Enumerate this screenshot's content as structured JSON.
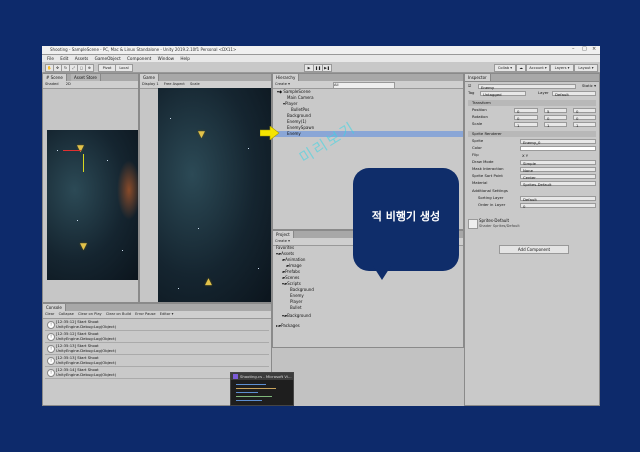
{
  "window": {
    "title": "Shooting - SampleScene - PC, Mac & Linux Standalone - Unity 2019.2.10f1 Personal <DX11>",
    "controls": [
      "–",
      "□",
      "×"
    ]
  },
  "menu": [
    "File",
    "Edit",
    "Assets",
    "GameObject",
    "Component",
    "Window",
    "Help"
  ],
  "toolbar": {
    "pivot_label": "Pivot",
    "local_label": "Local",
    "collab_label": "Collab ▾",
    "account_label": "Account ▾",
    "layers_label": "Layers ▾",
    "layout_label": "Layout ▾",
    "play_icons": [
      "▶",
      "❚❚",
      "▶❚"
    ]
  },
  "scene_panel": {
    "tabs": [
      "# Scene",
      "Asset Store"
    ],
    "shaded_label": "Shaded",
    "mode_label": "2D"
  },
  "game_panel": {
    "tab": "Game",
    "display_label": "Display 1",
    "resolution_label": "Free Aspect",
    "scale_label": "Scale"
  },
  "hierarchy": {
    "tab": "Hierarchy",
    "create_label": "Create ▾",
    "search_placeholder": "All",
    "scene_name": "SampleScene",
    "items": [
      "Main Camera",
      "Player",
      "BulletPos",
      "Background",
      "Enemy(1)",
      "EnemySpawn",
      "Enemy"
    ],
    "selected_index": 6
  },
  "project": {
    "tab": "Project",
    "create_label": "Create ▾",
    "tree": [
      "Favorites",
      "Assets",
      "Animation",
      "Image",
      "Prefabs",
      "Scenes",
      "Scripts",
      "Background",
      "Enemy",
      "Player",
      "Bullet",
      "Background",
      "Packages"
    ]
  },
  "inspector": {
    "tab": "Inspector",
    "object_name": "Enemy",
    "tag_label": "Tag",
    "tag_value": "Untagged",
    "layer_label": "Layer",
    "layer_value": "Default",
    "static_label": "Static ▾",
    "transform_title": "Transform",
    "transform": [
      {
        "label": "Position",
        "x": "0",
        "y": "5",
        "z": "0"
      },
      {
        "label": "Rotation",
        "x": "0",
        "y": "0",
        "z": "0"
      },
      {
        "label": "Scale",
        "x": "1",
        "y": "1",
        "z": "1"
      }
    ],
    "sprite_renderer_title": "Sprite Renderer",
    "sprite_rows": [
      {
        "label": "Sprite",
        "value": "Enemy_0"
      },
      {
        "label": "Color",
        "value": ""
      },
      {
        "label": "Flip",
        "value": "X  Y"
      },
      {
        "label": "Draw Mode",
        "value": "Simple"
      },
      {
        "label": "Mask Interaction",
        "value": "None"
      },
      {
        "label": "Sprite Sort Point",
        "value": "Center"
      },
      {
        "label": "Material",
        "value": "Sprites-Default"
      }
    ],
    "additional_title": "Additional Settings",
    "additional_rows": [
      {
        "label": "Sorting Layer",
        "value": "Default"
      },
      {
        "label": "Order in Layer",
        "value": "0"
      }
    ],
    "material_name": "Sprites-Default",
    "shader_label": "Shader  Sprites/Default",
    "add_component_label": "Add Component"
  },
  "console": {
    "tab": "Console",
    "buttons": [
      "Clear",
      "Collapse",
      "Clear on Play",
      "Clear on Build",
      "Error Pause",
      "Editor ▾"
    ],
    "entries": [
      {
        "line1": "[12:35:12] Start Shoot",
        "line2": "UnityEngine.Debug:Log(Object)"
      },
      {
        "line1": "[12:35:12] Start Shoot",
        "line2": "UnityEngine.Debug:Log(Object)"
      },
      {
        "line1": "[12:35:13] Start Shoot",
        "line2": "UnityEngine.Debug:Log(Object)"
      },
      {
        "line1": "[12:35:13] Start Shoot",
        "line2": "UnityEngine.Debug:Log(Object)"
      },
      {
        "line1": "[12:35:14] Start Shoot",
        "line2": "UnityEngine.Debug:Log(Object)"
      }
    ]
  },
  "vscode_thumbnail": {
    "title": "Shooting.cs - Microsoft Vi..."
  },
  "overlay": {
    "callout_text": "적 비행기 생성",
    "watermark_text": "미리보기"
  },
  "colors": {
    "background": "#0d2a6b",
    "callout": "#0f2d6a",
    "arrow": "#f5e400",
    "watermark": "#36d6e6",
    "selection": "#8aa6d6"
  }
}
